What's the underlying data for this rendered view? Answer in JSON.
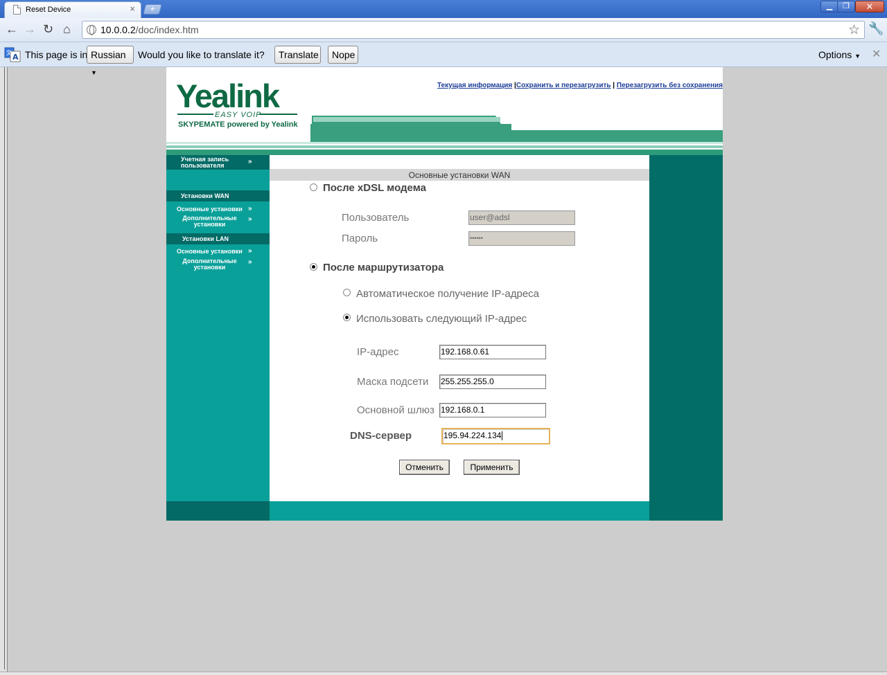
{
  "browser": {
    "tab_title": "Reset Device",
    "tab_close": "×",
    "new_tab": "+",
    "win_min": "▁",
    "win_max": "❐",
    "win_close": "✕",
    "url_host": "10.0.0.2",
    "url_path": "/doc/index.htm",
    "icons": {
      "back": "←",
      "forward": "→",
      "reload": "↻",
      "home": "⌂",
      "star": "☆",
      "wrench": "🔧"
    }
  },
  "infobar": {
    "page_is": "This page is in",
    "language": "Russian",
    "question": "Would you like to translate it?",
    "translate": "Translate",
    "nope": "Nope",
    "options": "Options",
    "close": "✕"
  },
  "header": {
    "logo": "Yealink",
    "tagline": "EASY VOIP",
    "subline": "SKYPEMATE powered by Yealink",
    "links": [
      "Текущая информация",
      "Сохранить и перезагрузить",
      "Перезагрузить без сохранения"
    ],
    "link_separator": "|"
  },
  "sidebar": {
    "account": {
      "line1": "Учетная запись",
      "line2": "пользователя"
    },
    "wan_head": "Установки WAN",
    "wan_basic": "Основные установки",
    "wan_adv": {
      "line1": "Дополнительные",
      "line2": "установки"
    },
    "lan_head": "Установки LAN",
    "lan_basic": "Основные установки",
    "lan_adv": {
      "line1": "Дополнительные",
      "line2": "установки"
    },
    "chevron": "»"
  },
  "form": {
    "title": "Основные установки WAN",
    "xdsl": {
      "label": "После xDSL модема",
      "checked": false,
      "user_label": "Пользователь",
      "user_value": "user@adsl",
      "password_label": "Пароль",
      "password_value": "••••••"
    },
    "router": {
      "label": "После маршрутизатора",
      "checked": true,
      "auto_ip_label": "Автоматическое получение IP-адреса",
      "static_ip_label": "Использовать следующий IP-адрес",
      "ip_label": "IP-адрес",
      "ip_value": "192.168.0.61",
      "mask_label": "Маска подсети",
      "mask_value": "255.255.255.0",
      "gateway_label": "Основной шлюз",
      "gateway_value": "192.168.0.1",
      "dns_label": "DNS-сервер",
      "dns_value": "195.94.224.134"
    },
    "cancel": "Отменить",
    "apply": "Применить"
  }
}
